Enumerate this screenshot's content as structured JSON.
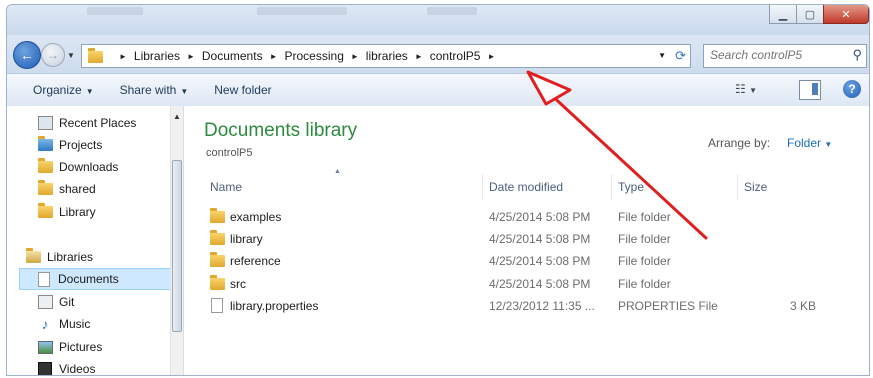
{
  "address": {
    "breadcrumbs": [
      "Libraries",
      "Documents",
      "Processing",
      "libraries",
      "controlP5"
    ],
    "search_placeholder": "Search controlP5"
  },
  "toolbar": {
    "organize_label": "Organize",
    "share_label": "Share with",
    "new_folder_label": "New folder"
  },
  "nav": {
    "items": [
      {
        "label": "Recent Places",
        "icon": "recent-places-icon"
      },
      {
        "label": "Projects",
        "icon": "projects-icon"
      },
      {
        "label": "Downloads",
        "icon": "downloads-icon"
      },
      {
        "label": "shared",
        "icon": "folder-icon"
      },
      {
        "label": "Library",
        "icon": "folder-icon"
      },
      {
        "label": "Libraries",
        "icon": "libraries-icon"
      },
      {
        "label": "Documents",
        "icon": "documents-icon",
        "selected": true
      },
      {
        "label": "Git",
        "icon": "git-icon"
      },
      {
        "label": "Music",
        "icon": "music-icon"
      },
      {
        "label": "Pictures",
        "icon": "pictures-icon"
      },
      {
        "label": "Videos",
        "icon": "videos-icon"
      }
    ]
  },
  "content": {
    "title": "Documents library",
    "subtitle": "controlP5",
    "arrange_label": "Arrange by:",
    "arrange_value": "Folder",
    "columns": [
      "Name",
      "Date modified",
      "Type",
      "Size"
    ],
    "rows": [
      {
        "name": "examples",
        "date": "4/25/2014 5:08 PM",
        "type": "File folder",
        "size": "",
        "kind": "folder"
      },
      {
        "name": "library",
        "date": "4/25/2014 5:08 PM",
        "type": "File folder",
        "size": "",
        "kind": "folder"
      },
      {
        "name": "reference",
        "date": "4/25/2014 5:08 PM",
        "type": "File folder",
        "size": "",
        "kind": "folder"
      },
      {
        "name": "src",
        "date": "4/25/2014 5:08 PM",
        "type": "File folder",
        "size": "",
        "kind": "folder"
      },
      {
        "name": "library.properties",
        "date": "12/23/2012 11:35 ...",
        "type": "PROPERTIES File",
        "size": "3 KB",
        "kind": "file"
      }
    ]
  },
  "colors": {
    "title_green": "#2d8a3e",
    "link_blue": "#1e6cbf",
    "annotation_red": "#e02020"
  }
}
